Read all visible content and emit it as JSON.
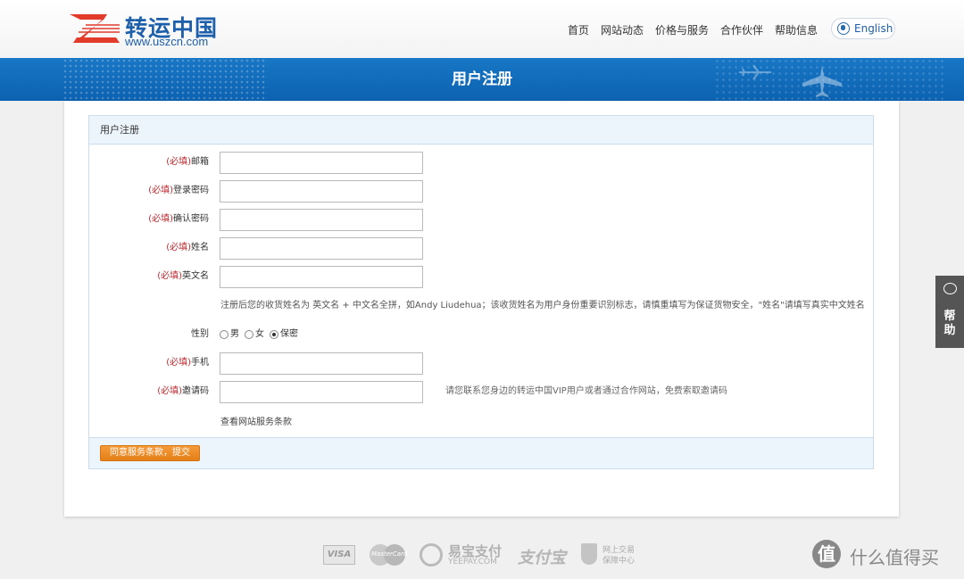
{
  "header": {
    "logo_cn": "转运中国",
    "logo_url": "www.uszcn.com",
    "nav": [
      "首页",
      "网站动态",
      "价格与服务",
      "合作伙伴",
      "帮助信息"
    ],
    "lang_button": "English"
  },
  "banner": {
    "title": "用户注册"
  },
  "panel": {
    "title": "用户注册",
    "required_tag": "(必填)",
    "fields": {
      "email": {
        "label": "邮箱",
        "value": ""
      },
      "password": {
        "label": "登录密码",
        "value": ""
      },
      "confirm": {
        "label": "确认密码",
        "value": ""
      },
      "name": {
        "label": "姓名",
        "value": ""
      },
      "english_name": {
        "label": "英文名",
        "value": ""
      },
      "phone": {
        "label": "手机",
        "value": ""
      },
      "invite": {
        "label": "邀请码",
        "value": ""
      }
    },
    "name_hint": "注册后您的收货姓名为 英文名 + 中文名全拼，如Andy Liudehua；该收货姓名为用户身份重要识别标志，请慎重填写为保证货物安全，\"姓名\"请填写真实中文姓名",
    "gender": {
      "label": "性别",
      "options": [
        "男",
        "女",
        "保密"
      ],
      "selected": "保密"
    },
    "invite_hint": "请您联系您身边的转运中国VIP用户或者通过合作网站，免费索取邀请码",
    "terms_link": "查看网站服务条款",
    "submit": "同意服务条款，提交"
  },
  "help_tab": {
    "label": "帮助"
  },
  "footer": {
    "visa": "VISA",
    "mastercard": "MasterCard",
    "yeepay_cn": "易宝支付",
    "yeepay_en": "YEEPAY.COM",
    "alipay": "支付宝",
    "trade_line1": "网上交易",
    "trade_line2": "保障中心"
  },
  "watermark": {
    "icon": "值",
    "text": "什么值得买"
  },
  "colors": {
    "brand_blue": "#1877c6",
    "accent_orange": "#e98a24",
    "required_red": "#c1272d"
  }
}
